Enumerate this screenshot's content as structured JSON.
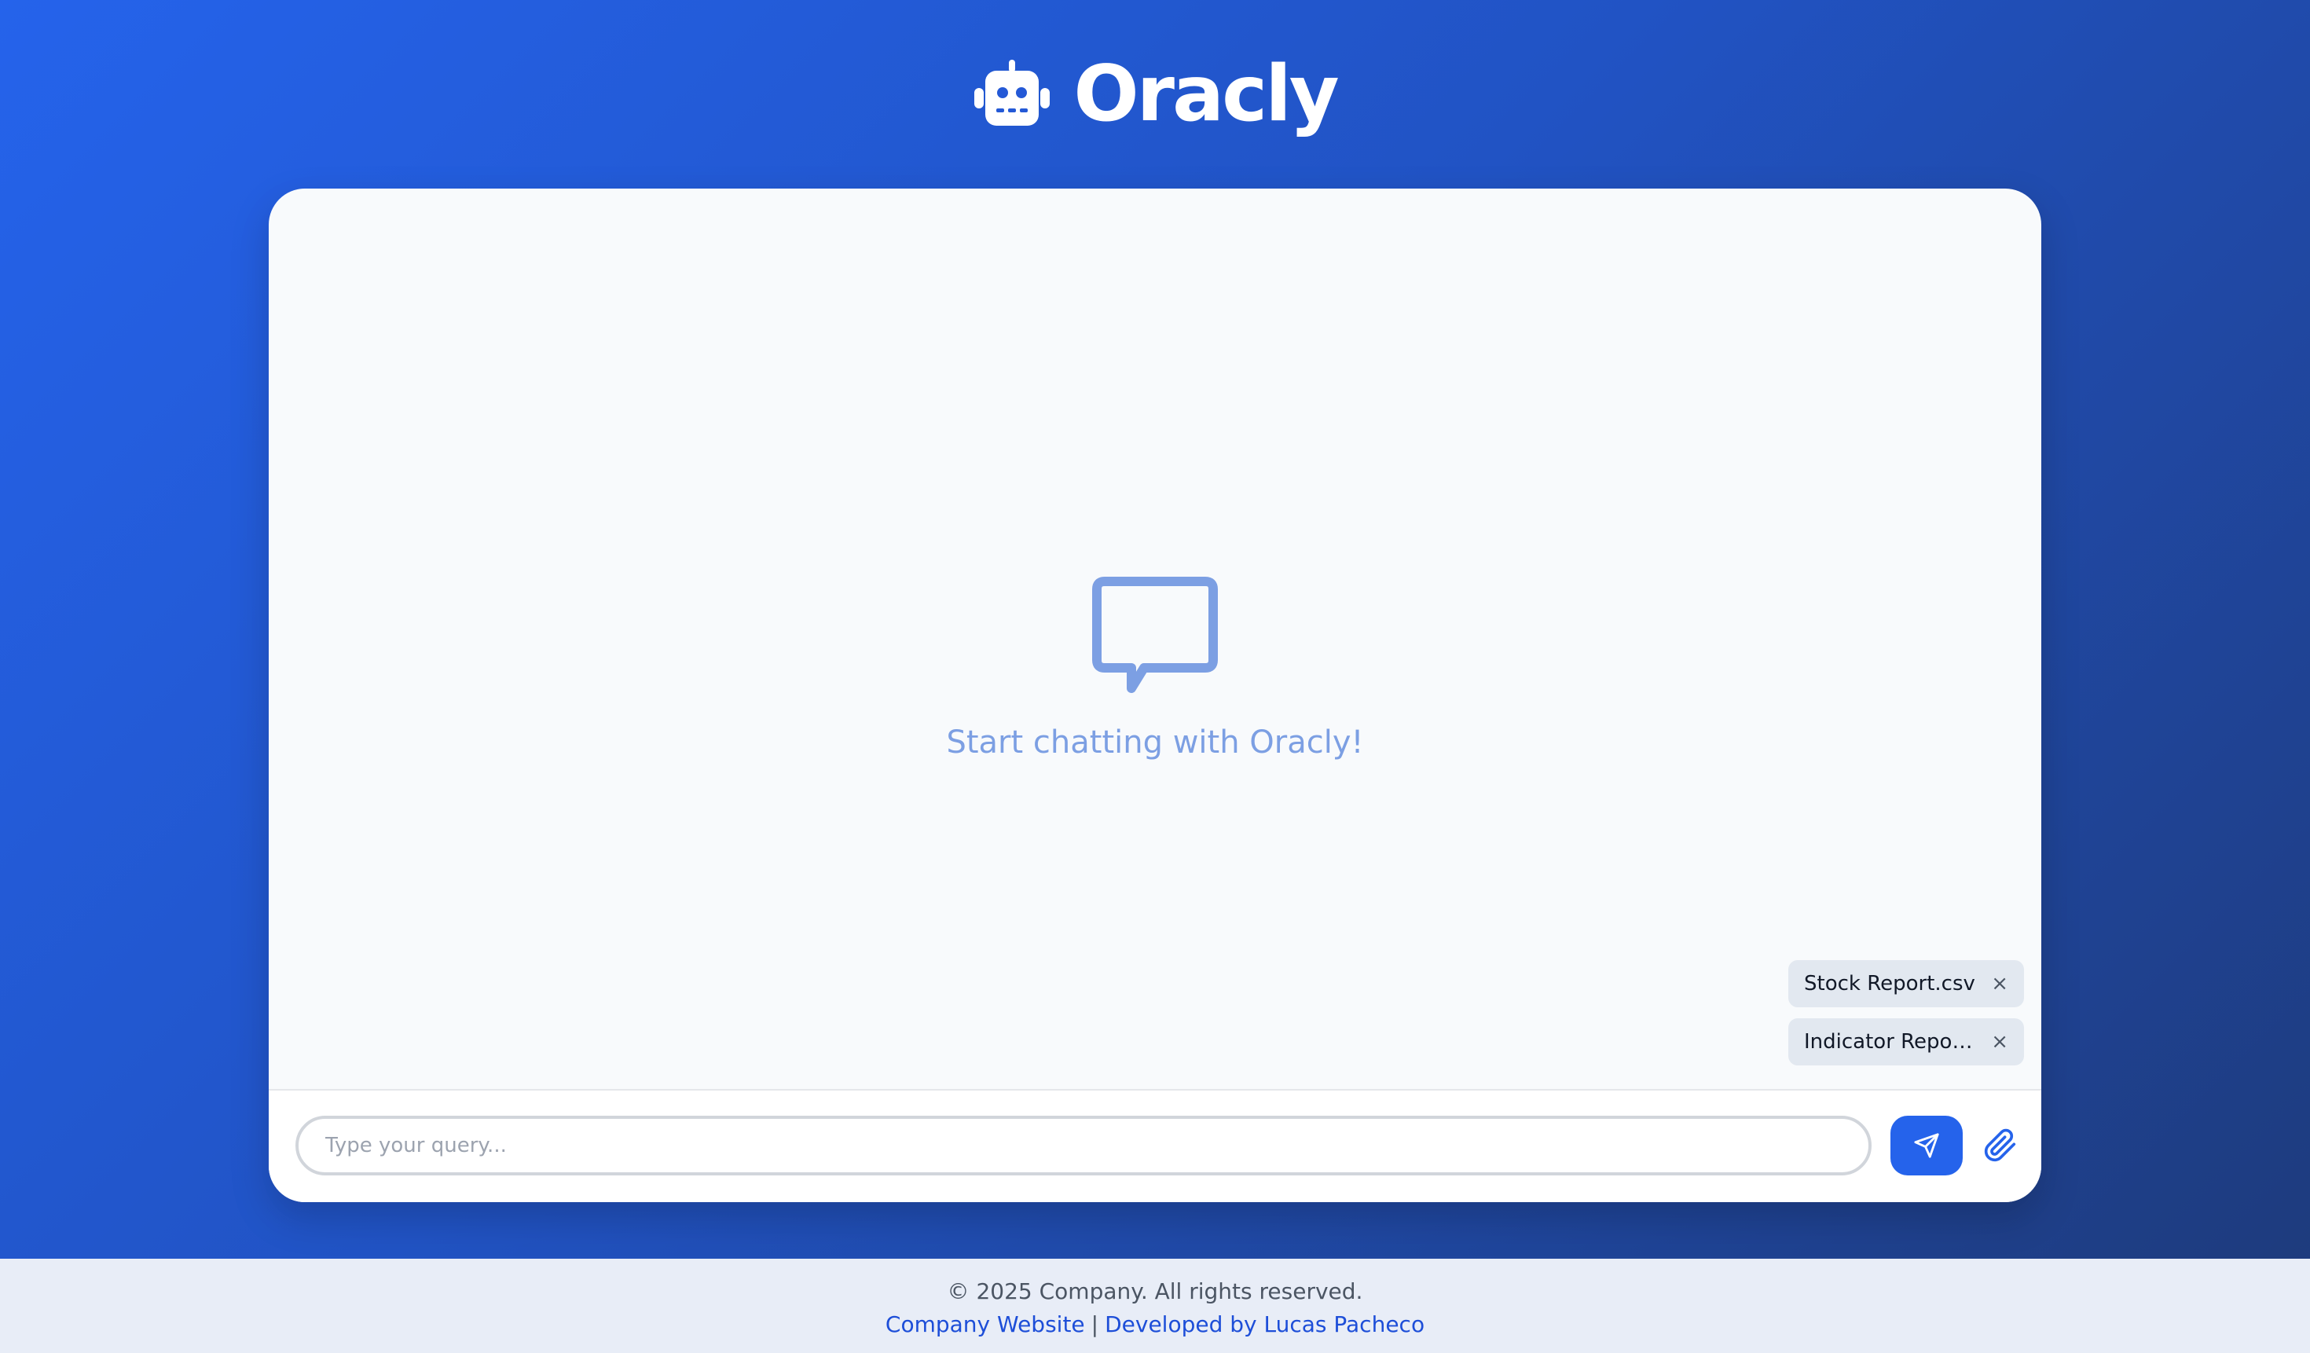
{
  "app": {
    "title": "Oracly",
    "logo_icon": "robot-icon"
  },
  "chat": {
    "empty_icon": "chat-bubble-icon",
    "empty_message": "Start chatting with Oracly!"
  },
  "attachments": [
    {
      "name": "Stock Report.csv",
      "remove_label": "×"
    },
    {
      "name": "Indicator Report...",
      "remove_label": "×"
    }
  ],
  "composer": {
    "placeholder": "Type your query...",
    "value": "",
    "send_icon": "send-icon",
    "attach_icon": "paperclip-icon"
  },
  "footer": {
    "copyright": "© 2025 Company. All rights reserved.",
    "links": [
      {
        "label": "Company Website"
      },
      {
        "label": "Developed by Lucas Pacheco"
      }
    ],
    "separator": "|"
  },
  "colors": {
    "accent": "#2563eb",
    "empty_state": "#7c9fe3",
    "link": "#1d4ed8"
  }
}
